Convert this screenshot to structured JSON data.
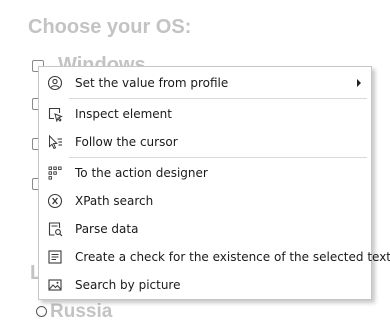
{
  "page": {
    "title": "Choose your OS:",
    "os_options": {
      "first_label": "Windows"
    },
    "language_heading": "L",
    "radio_option": {
      "label": "Russia"
    }
  },
  "context_menu": {
    "items": [
      {
        "label": "Set the value from profile",
        "icon": "user-circle-icon",
        "has_submenu": true
      },
      {
        "label": "Inspect element",
        "icon": "inspect-cursor-icon"
      },
      {
        "label": "Follow the cursor",
        "icon": "follow-cursor-icon"
      },
      {
        "label": "To the action designer",
        "icon": "grid-dots-icon"
      },
      {
        "label": "XPath search",
        "icon": "xpath-x-icon"
      },
      {
        "label": "Parse data",
        "icon": "parse-data-icon"
      },
      {
        "label": "Create a check for the existence of the selected text",
        "icon": "text-check-icon"
      },
      {
        "label": "Search by picture",
        "icon": "picture-icon"
      }
    ]
  },
  "colors": {
    "background_text": "#c3c3c3",
    "menu_background": "#ffffff",
    "menu_border": "#c6c6c6",
    "icon_stroke": "#3a3a3a"
  }
}
